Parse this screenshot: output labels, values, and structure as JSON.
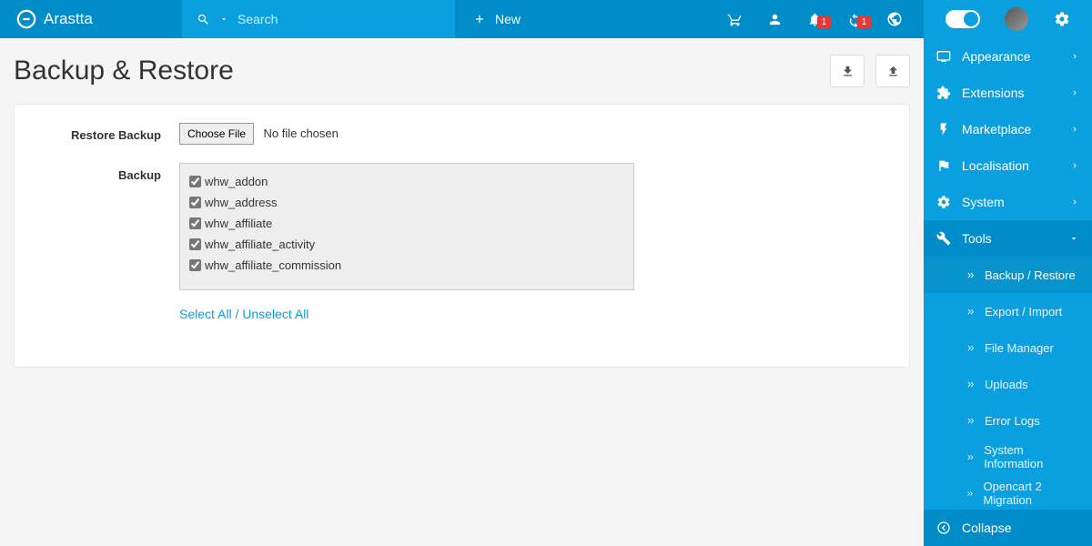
{
  "brand": "Arastta",
  "search": {
    "placeholder": "Search"
  },
  "newbtn": "New",
  "badges": {
    "bell": "1",
    "refresh": "1"
  },
  "sidebar": {
    "items": [
      {
        "label": "Appearance"
      },
      {
        "label": "Extensions"
      },
      {
        "label": "Marketplace"
      },
      {
        "label": "Localisation"
      },
      {
        "label": "System"
      },
      {
        "label": "Tools"
      }
    ],
    "tools_sub": [
      {
        "label": "Backup / Restore"
      },
      {
        "label": "Export / Import"
      },
      {
        "label": "File Manager"
      },
      {
        "label": "Uploads"
      },
      {
        "label": "Error Logs"
      },
      {
        "label": "System Information"
      },
      {
        "label": "Opencart 2 Migration"
      }
    ],
    "collapse": "Collapse"
  },
  "page": {
    "title": "Backup & Restore",
    "restore_label": "Restore Backup",
    "choose_file": "Choose File",
    "no_file": "No file chosen",
    "backup_label": "Backup",
    "tables": [
      "whw_addon",
      "whw_address",
      "whw_affiliate",
      "whw_affiliate_activity",
      "whw_affiliate_commission"
    ],
    "select_all": "Select All",
    "unselect_all": "Unselect All"
  }
}
